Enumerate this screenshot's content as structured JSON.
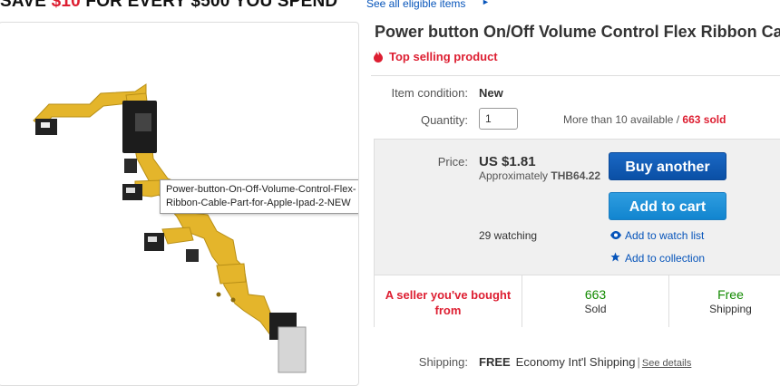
{
  "promo": {
    "prefix": "SAVE ",
    "amount": "$10",
    "suffix": " FOR EVERY $500 YOU SPEND",
    "link": "See all eligible items",
    "arrow": "►"
  },
  "image": {
    "tooltip": "Power-button-On-Off-Volume-Control-Flex-Ribbon-Cable-Part-for-Apple-Ipad-2-NEW"
  },
  "listing": {
    "title": "Power button On/Off Volume Control Flex Ribbon Ca",
    "badge": "Top selling product"
  },
  "condition": {
    "label": "Item condition:",
    "value": "New"
  },
  "quantity": {
    "label": "Quantity:",
    "value": "1",
    "available": "More than 10 available / ",
    "sold": "663 sold"
  },
  "price": {
    "label": "Price:",
    "value": "US $1.81",
    "approx_prefix": "Approximately ",
    "approx_value": "THB64.22"
  },
  "buttons": {
    "buy_another": "Buy another",
    "add_to_cart": "Add to cart"
  },
  "watch": {
    "count": "29 watching",
    "watch_link": "Add to watch list",
    "collection_link": "Add to collection"
  },
  "stats": {
    "seller": "A seller you've bought from",
    "sold_num": "663",
    "sold_label": "Sold",
    "ship_num": "Free",
    "ship_label": "Shipping"
  },
  "shipping": {
    "label": "Shipping:",
    "free": "FREE",
    "method": "Economy Int'l Shipping",
    "separator": "|",
    "details": "See details"
  },
  "colors": {
    "accent_red": "#dd1e31",
    "link_blue": "#0654ba",
    "buy_button": "#0f57b0",
    "cart_button": "#2594da",
    "free_green": "#128a00"
  },
  "icons": [
    "fire-icon",
    "eye-icon",
    "star-icon",
    "arrow-right-icon"
  ]
}
